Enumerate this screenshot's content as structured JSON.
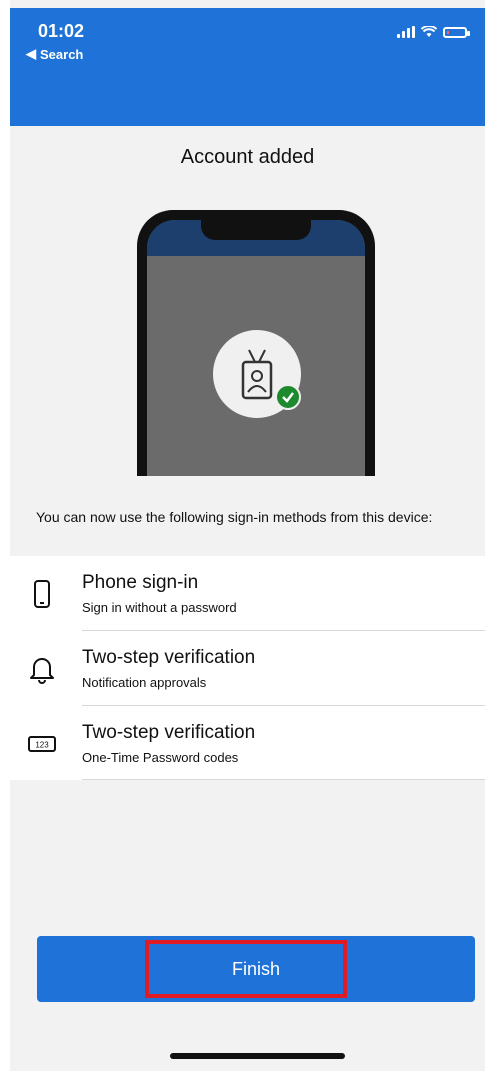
{
  "status_bar": {
    "time": "01:02",
    "back_label": "Search",
    "battery_level": 0.15
  },
  "page": {
    "title": "Account added",
    "description": "You can now use the following sign-in methods from this device:"
  },
  "methods": [
    {
      "label": "Phone sign-in",
      "sub": "Sign in without a password",
      "icon": "phone-icon"
    },
    {
      "label": "Two-step verification",
      "sub": "Notification approvals",
      "icon": "bell-icon"
    },
    {
      "label": "Two-step verification",
      "sub": "One-Time Password codes",
      "icon": "otp-code-icon",
      "icon_text": "123"
    }
  ],
  "actions": {
    "finish_label": "Finish"
  },
  "colors": {
    "accent": "#1f73d8",
    "highlight": "#e01b24",
    "success": "#1e8a2e"
  }
}
